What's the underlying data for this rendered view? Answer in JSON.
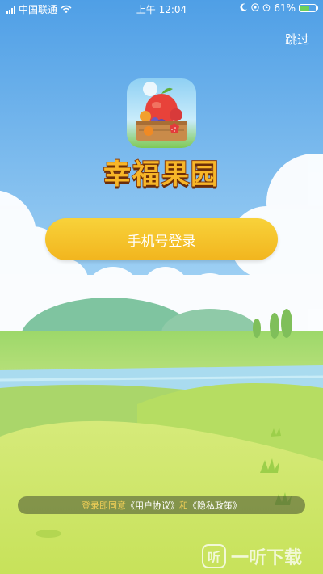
{
  "status_bar": {
    "carrier": "中国联通",
    "time": "上午 12:04",
    "battery": "61%",
    "battery_level": 0.61
  },
  "skip_label": "跳过",
  "app": {
    "title": "幸福果园"
  },
  "login_button": {
    "label": "手机号登录"
  },
  "agreement": {
    "prefix": "登录即同意",
    "terms_link": "《用户协议》",
    "connector": "和",
    "privacy_link": "《隐私政策》"
  },
  "watermark": {
    "glyph": "听",
    "text": "一听下载"
  },
  "colors": {
    "sky_top": "#4f9fe6",
    "button": "#f5c42c",
    "title": "#f7b628"
  }
}
